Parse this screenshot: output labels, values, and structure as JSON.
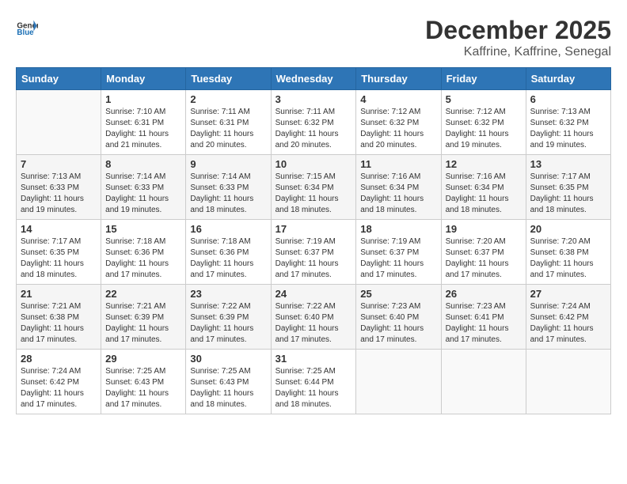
{
  "header": {
    "logo_general": "General",
    "logo_blue": "Blue",
    "month_title": "December 2025",
    "location": "Kaffrine, Kaffrine, Senegal"
  },
  "weekdays": [
    "Sunday",
    "Monday",
    "Tuesday",
    "Wednesday",
    "Thursday",
    "Friday",
    "Saturday"
  ],
  "weeks": [
    [
      {
        "day": "",
        "info": ""
      },
      {
        "day": "1",
        "info": "Sunrise: 7:10 AM\nSunset: 6:31 PM\nDaylight: 11 hours\nand 21 minutes."
      },
      {
        "day": "2",
        "info": "Sunrise: 7:11 AM\nSunset: 6:31 PM\nDaylight: 11 hours\nand 20 minutes."
      },
      {
        "day": "3",
        "info": "Sunrise: 7:11 AM\nSunset: 6:32 PM\nDaylight: 11 hours\nand 20 minutes."
      },
      {
        "day": "4",
        "info": "Sunrise: 7:12 AM\nSunset: 6:32 PM\nDaylight: 11 hours\nand 20 minutes."
      },
      {
        "day": "5",
        "info": "Sunrise: 7:12 AM\nSunset: 6:32 PM\nDaylight: 11 hours\nand 19 minutes."
      },
      {
        "day": "6",
        "info": "Sunrise: 7:13 AM\nSunset: 6:32 PM\nDaylight: 11 hours\nand 19 minutes."
      }
    ],
    [
      {
        "day": "7",
        "info": "Sunrise: 7:13 AM\nSunset: 6:33 PM\nDaylight: 11 hours\nand 19 minutes."
      },
      {
        "day": "8",
        "info": "Sunrise: 7:14 AM\nSunset: 6:33 PM\nDaylight: 11 hours\nand 19 minutes."
      },
      {
        "day": "9",
        "info": "Sunrise: 7:14 AM\nSunset: 6:33 PM\nDaylight: 11 hours\nand 18 minutes."
      },
      {
        "day": "10",
        "info": "Sunrise: 7:15 AM\nSunset: 6:34 PM\nDaylight: 11 hours\nand 18 minutes."
      },
      {
        "day": "11",
        "info": "Sunrise: 7:16 AM\nSunset: 6:34 PM\nDaylight: 11 hours\nand 18 minutes."
      },
      {
        "day": "12",
        "info": "Sunrise: 7:16 AM\nSunset: 6:34 PM\nDaylight: 11 hours\nand 18 minutes."
      },
      {
        "day": "13",
        "info": "Sunrise: 7:17 AM\nSunset: 6:35 PM\nDaylight: 11 hours\nand 18 minutes."
      }
    ],
    [
      {
        "day": "14",
        "info": "Sunrise: 7:17 AM\nSunset: 6:35 PM\nDaylight: 11 hours\nand 18 minutes."
      },
      {
        "day": "15",
        "info": "Sunrise: 7:18 AM\nSunset: 6:36 PM\nDaylight: 11 hours\nand 17 minutes."
      },
      {
        "day": "16",
        "info": "Sunrise: 7:18 AM\nSunset: 6:36 PM\nDaylight: 11 hours\nand 17 minutes."
      },
      {
        "day": "17",
        "info": "Sunrise: 7:19 AM\nSunset: 6:37 PM\nDaylight: 11 hours\nand 17 minutes."
      },
      {
        "day": "18",
        "info": "Sunrise: 7:19 AM\nSunset: 6:37 PM\nDaylight: 11 hours\nand 17 minutes."
      },
      {
        "day": "19",
        "info": "Sunrise: 7:20 AM\nSunset: 6:37 PM\nDaylight: 11 hours\nand 17 minutes."
      },
      {
        "day": "20",
        "info": "Sunrise: 7:20 AM\nSunset: 6:38 PM\nDaylight: 11 hours\nand 17 minutes."
      }
    ],
    [
      {
        "day": "21",
        "info": "Sunrise: 7:21 AM\nSunset: 6:38 PM\nDaylight: 11 hours\nand 17 minutes."
      },
      {
        "day": "22",
        "info": "Sunrise: 7:21 AM\nSunset: 6:39 PM\nDaylight: 11 hours\nand 17 minutes."
      },
      {
        "day": "23",
        "info": "Sunrise: 7:22 AM\nSunset: 6:39 PM\nDaylight: 11 hours\nand 17 minutes."
      },
      {
        "day": "24",
        "info": "Sunrise: 7:22 AM\nSunset: 6:40 PM\nDaylight: 11 hours\nand 17 minutes."
      },
      {
        "day": "25",
        "info": "Sunrise: 7:23 AM\nSunset: 6:40 PM\nDaylight: 11 hours\nand 17 minutes."
      },
      {
        "day": "26",
        "info": "Sunrise: 7:23 AM\nSunset: 6:41 PM\nDaylight: 11 hours\nand 17 minutes."
      },
      {
        "day": "27",
        "info": "Sunrise: 7:24 AM\nSunset: 6:42 PM\nDaylight: 11 hours\nand 17 minutes."
      }
    ],
    [
      {
        "day": "28",
        "info": "Sunrise: 7:24 AM\nSunset: 6:42 PM\nDaylight: 11 hours\nand 17 minutes."
      },
      {
        "day": "29",
        "info": "Sunrise: 7:25 AM\nSunset: 6:43 PM\nDaylight: 11 hours\nand 17 minutes."
      },
      {
        "day": "30",
        "info": "Sunrise: 7:25 AM\nSunset: 6:43 PM\nDaylight: 11 hours\nand 18 minutes."
      },
      {
        "day": "31",
        "info": "Sunrise: 7:25 AM\nSunset: 6:44 PM\nDaylight: 11 hours\nand 18 minutes."
      },
      {
        "day": "",
        "info": ""
      },
      {
        "day": "",
        "info": ""
      },
      {
        "day": "",
        "info": ""
      }
    ]
  ]
}
